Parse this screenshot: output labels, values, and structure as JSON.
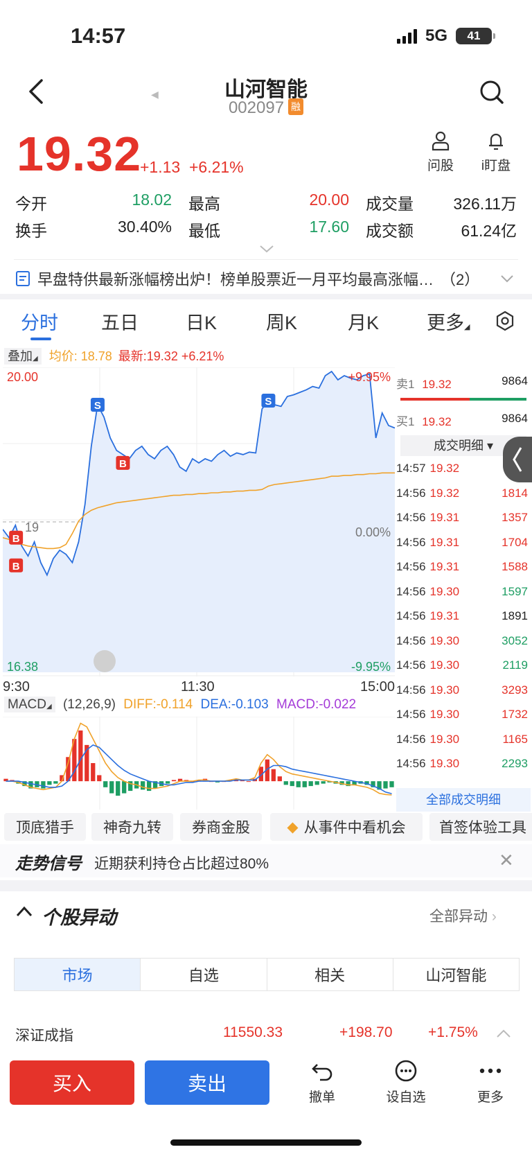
{
  "status": {
    "time": "14:57",
    "network": "5G",
    "battery": "41"
  },
  "header": {
    "name": "山河智能",
    "code": "002097",
    "margin_badge": "融"
  },
  "quote": {
    "price": "19.32",
    "change": "+1.13",
    "change_pct": "+6.21%",
    "tools": [
      {
        "label": "问股"
      },
      {
        "label": "i盯盘"
      }
    ],
    "stats": [
      {
        "label": "今开",
        "value": "18.02",
        "color": "green"
      },
      {
        "label": "最高",
        "value": "20.00",
        "color": "red"
      },
      {
        "label": "成交量",
        "value": "326.11万",
        "color": "black"
      },
      {
        "label": "换手",
        "value": "30.40%",
        "color": "black"
      },
      {
        "label": "最低",
        "value": "17.60",
        "color": "green"
      },
      {
        "label": "成交额",
        "value": "61.24亿",
        "color": "black"
      }
    ]
  },
  "news": {
    "text": "早盘特供最新涨幅榜出炉！榜单股票近一月平均最高涨幅…",
    "count": "（2）"
  },
  "chart_tabs": [
    "分时",
    "五日",
    "日K",
    "周K",
    "月K",
    "更多"
  ],
  "overlay": {
    "label": "叠加",
    "avg": "均价: 18.78",
    "latest": "最新:19.32 +6.21%"
  },
  "chart_data": [
    {
      "type": "line",
      "title": "",
      "x_ticks": [
        "9:30",
        "11:30",
        "15:00"
      ],
      "y_labels_left": [
        "20.00",
        "16.38"
      ],
      "y_labels_right": [
        "+9.95%",
        "0.00%",
        "-9.95%"
      ],
      "prev_close_label": "19",
      "ylim": [
        16.38,
        20.0
      ],
      "series": [
        {
          "name": "",
          "values": [
            18.1,
            18.0,
            18.15,
            17.9,
            17.78,
            17.95,
            17.7,
            17.55,
            17.75,
            17.85,
            17.8,
            17.7,
            17.95,
            18.4,
            19.1,
            19.6,
            19.45,
            19.2,
            19.05,
            19.0,
            18.95,
            19.05,
            19.1,
            19.0,
            18.95,
            19.05,
            19.1,
            19.0,
            18.85,
            18.8,
            18.95,
            18.9,
            18.95,
            18.92,
            19.0,
            19.05,
            18.98,
            19.02,
            19.0,
            19.03,
            19.02,
            19.55,
            19.65,
            19.6,
            19.58,
            19.7,
            19.72,
            19.75,
            19.78,
            19.82,
            19.8,
            19.95,
            20.0,
            19.9,
            19.95,
            19.92,
            19.9,
            19.95,
            19.97,
            19.2,
            19.5,
            19.35,
            19.32
          ]
        },
        {
          "name": "",
          "values": [
            18.0,
            17.98,
            17.95,
            17.92,
            17.9,
            17.89,
            17.88,
            17.87,
            17.87,
            17.88,
            17.92,
            18.05,
            18.2,
            18.28,
            18.33,
            18.36,
            18.38,
            18.4,
            18.42,
            18.43,
            18.44,
            18.45,
            18.46,
            18.47,
            18.48,
            18.49,
            18.5,
            18.51,
            18.51,
            18.52,
            18.52,
            18.53,
            18.53,
            18.54,
            18.54,
            18.55,
            18.55,
            18.56,
            18.56,
            18.57,
            18.57,
            18.58,
            18.62,
            18.64,
            18.65,
            18.66,
            18.67,
            18.68,
            18.69,
            18.7,
            18.71,
            18.72,
            18.74,
            18.74,
            18.75,
            18.75,
            18.76,
            18.76,
            18.77,
            18.77,
            18.78,
            18.78,
            18.78
          ]
        }
      ],
      "markers": [
        {
          "label": "B",
          "index": 1,
          "value": 18.0
        },
        {
          "label": "B",
          "index": 1,
          "value": 17.8
        },
        {
          "label": "S",
          "index": 15,
          "value": 19.6
        },
        {
          "label": "B",
          "index": 19,
          "value": 18.9
        },
        {
          "label": "S",
          "index": 42,
          "value": 19.65
        }
      ],
      "grid": true
    },
    {
      "type": "bar",
      "title": "",
      "params": "(12,26,9)",
      "diff": "DIFF:-0.114",
      "dea": "DEA:-0.103",
      "macd": "MACD:-0.022",
      "values": [
        0.02,
        0.01,
        -0.02,
        -0.04,
        -0.06,
        -0.05,
        -0.06,
        -0.03,
        -0.02,
        0.05,
        0.2,
        0.35,
        0.42,
        0.3,
        0.15,
        0.05,
        -0.05,
        -0.1,
        -0.12,
        -0.1,
        -0.08,
        -0.06,
        -0.07,
        -0.08,
        -0.06,
        -0.04,
        -0.02,
        0.01,
        0.02,
        0.01,
        0.0,
        0.01,
        0.02,
        0.0,
        -0.01,
        0.0,
        0.01,
        0.02,
        0.01,
        0.0,
        0.02,
        0.12,
        0.18,
        0.1,
        0.04,
        -0.03,
        -0.04,
        -0.05,
        -0.05,
        -0.04,
        -0.03,
        -0.02,
        -0.01,
        -0.02,
        -0.03,
        -0.04,
        -0.03,
        -0.02,
        -0.03,
        -0.05,
        -0.07,
        -0.06,
        -0.05
      ],
      "diff_values": [
        0.0,
        0.0,
        -0.01,
        -0.03,
        -0.05,
        -0.06,
        -0.07,
        -0.06,
        -0.05,
        0.0,
        0.15,
        0.35,
        0.48,
        0.45,
        0.35,
        0.25,
        0.15,
        0.08,
        0.03,
        0.0,
        -0.02,
        -0.03,
        -0.05,
        -0.06,
        -0.06,
        -0.05,
        -0.04,
        -0.02,
        0.0,
        0.0,
        0.0,
        0.01,
        0.01,
        0.0,
        0.0,
        0.0,
        0.01,
        0.02,
        0.01,
        0.01,
        0.03,
        0.15,
        0.22,
        0.18,
        0.12,
        0.08,
        0.06,
        0.05,
        0.04,
        0.03,
        0.02,
        0.01,
        0.0,
        -0.01,
        -0.02,
        -0.03,
        -0.03,
        -0.04,
        -0.05,
        -0.07,
        -0.1,
        -0.11,
        -0.114
      ],
      "dea_values": [
        0.0,
        0.0,
        0.0,
        -0.01,
        -0.02,
        -0.03,
        -0.04,
        -0.05,
        -0.05,
        -0.04,
        0.0,
        0.08,
        0.18,
        0.26,
        0.3,
        0.28,
        0.23,
        0.18,
        0.13,
        0.09,
        0.06,
        0.04,
        0.02,
        0.0,
        -0.01,
        -0.02,
        -0.03,
        -0.03,
        -0.02,
        -0.01,
        -0.01,
        0.0,
        0.0,
        0.0,
        0.0,
        0.0,
        0.0,
        0.01,
        0.01,
        0.01,
        0.01,
        0.05,
        0.1,
        0.13,
        0.13,
        0.12,
        0.1,
        0.09,
        0.08,
        0.07,
        0.06,
        0.05,
        0.04,
        0.03,
        0.02,
        0.01,
        0.0,
        -0.01,
        -0.02,
        -0.04,
        -0.06,
        -0.09,
        -0.103
      ],
      "ylim": [
        -0.2,
        0.5
      ]
    }
  ],
  "orderbook": {
    "sell": {
      "label": "卖1",
      "price": "19.32",
      "vol": "9864"
    },
    "buy": {
      "label": "买1",
      "price": "19.32",
      "vol": "9864"
    },
    "detail_label": "成交明细",
    "trades": [
      {
        "time": "14:57",
        "price": "19.32",
        "vol": "",
        "color": "green"
      },
      {
        "time": "14:56",
        "price": "19.32",
        "vol": "1814",
        "color": "red"
      },
      {
        "time": "14:56",
        "price": "19.31",
        "vol": "1357",
        "color": "red"
      },
      {
        "time": "14:56",
        "price": "19.31",
        "vol": "1704",
        "color": "red"
      },
      {
        "time": "14:56",
        "price": "19.31",
        "vol": "1588",
        "color": "red"
      },
      {
        "time": "14:56",
        "price": "19.30",
        "vol": "1597",
        "color": "green"
      },
      {
        "time": "14:56",
        "price": "19.31",
        "vol": "1891",
        "color": "black"
      },
      {
        "time": "14:56",
        "price": "19.30",
        "vol": "3052",
        "color": "green"
      },
      {
        "time": "14:56",
        "price": "19.30",
        "vol": "2119",
        "color": "green"
      },
      {
        "time": "14:56",
        "price": "19.30",
        "vol": "3293",
        "color": "red"
      },
      {
        "time": "14:56",
        "price": "19.30",
        "vol": "1732",
        "color": "red"
      },
      {
        "time": "14:56",
        "price": "19.30",
        "vol": "1165",
        "color": "red"
      },
      {
        "time": "14:56",
        "price": "19.30",
        "vol": "2293",
        "color": "green"
      }
    ],
    "all_label": "全部成交明细"
  },
  "macd": {
    "label": "MACD"
  },
  "shortcuts": [
    "顶底猎手",
    "神奇九转",
    "券商金股",
    "从事件中看机会",
    "首签体验工具"
  ],
  "signal": {
    "title": "走势信号",
    "text": "近期获利持仓占比超过80%"
  },
  "section": {
    "title": "个股异动",
    "link": "全部异动"
  },
  "segments": [
    "市场",
    "自选",
    "相关",
    "山河智能"
  ],
  "index_row": {
    "name": "深证成指",
    "value": "11550.33",
    "change": "+198.70",
    "pct": "+1.75%"
  },
  "bottom": {
    "buy": "买入",
    "sell": "卖出",
    "tools": [
      "撤单",
      "设自选",
      "更多"
    ]
  },
  "colors": {
    "red": "#e5332a",
    "green": "#1e9e63",
    "blue": "#2a6fde",
    "orange": "#f0a22a"
  }
}
